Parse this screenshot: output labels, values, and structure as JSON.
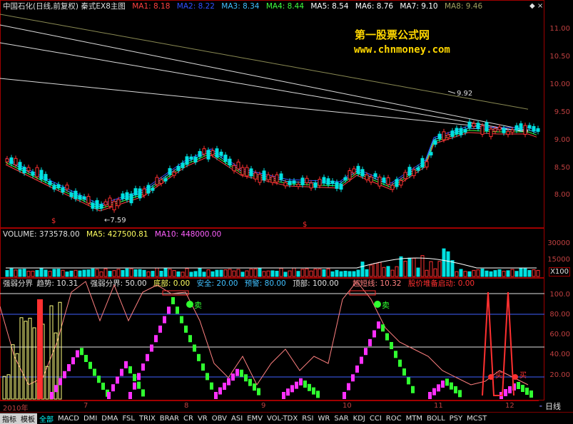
{
  "main_header": {
    "title": "中国石化(日线,前复权) 秦式EX8主图",
    "ma": [
      {
        "label": "MA1: 8.18",
        "color": "#ff4040"
      },
      {
        "label": "MA2: 8.22",
        "color": "#3050ff"
      },
      {
        "label": "MA3: 8.34",
        "color": "#40c0ff"
      },
      {
        "label": "MA4: 8.44",
        "color": "#40ff40"
      },
      {
        "label": "MA5: 8.54",
        "color": "#ffffff"
      },
      {
        "label": "MA6: 8.76",
        "color": "#ffffff"
      },
      {
        "label": "MA7: 9.10",
        "color": "#ffffff"
      },
      {
        "label": "MA8: 9.46",
        "color": "#a0a060"
      }
    ]
  },
  "watermark": {
    "line1": "第一股票公式网",
    "line2": "www.chnmoney.com"
  },
  "price_axis": [
    "11.00",
    "10.50",
    "10.00",
    "9.50",
    "9.00",
    "8.50",
    "8.00"
  ],
  "price_annotations": {
    "high": "9.92",
    "low": "7.59"
  },
  "volume_header": {
    "volume": "VOLUME: 373578.00",
    "ma5": "MA5: 427500.81",
    "ma10": "MA10: 448000.00"
  },
  "volume_axis": [
    "30000",
    "15000"
  ],
  "volume_unit": "X100",
  "indicator_header": {
    "a": "强弱分界",
    "b": "趋势: 10.31",
    "c": "强弱分界: 50.00",
    "d": "底部: 0.00",
    "e": "安全: 20.00",
    "f": "预警: 80.00",
    "g": "顶部: 100.00",
    "h": "超短线: 10.32",
    "i": "股价堆备启动: 0.00"
  },
  "indicator_axis": [
    "100.0",
    "80.00",
    "60.00",
    "40.00",
    "20.00"
  ],
  "sell_label": "卖",
  "buy_label": "买",
  "x_axis": [
    "2010年",
    "7",
    "8",
    "9",
    "10",
    "11",
    "12"
  ],
  "tabs": [
    "指标",
    "模板",
    "全部",
    "MACD",
    "DMI",
    "DMA",
    "FSL",
    "TRIX",
    "BRAR",
    "CR",
    "VR",
    "OBV",
    "ASI",
    "EMV",
    "VOL-TDX",
    "RSI",
    "WR",
    "SAR",
    "KDJ",
    "CCI",
    "ROC",
    "MTM",
    "BOLL",
    "PSY",
    "MCST"
  ],
  "period_button": "日线",
  "colors": {
    "up": "#ff3030",
    "down": "#00e0e0",
    "grid": "#a00000"
  }
}
